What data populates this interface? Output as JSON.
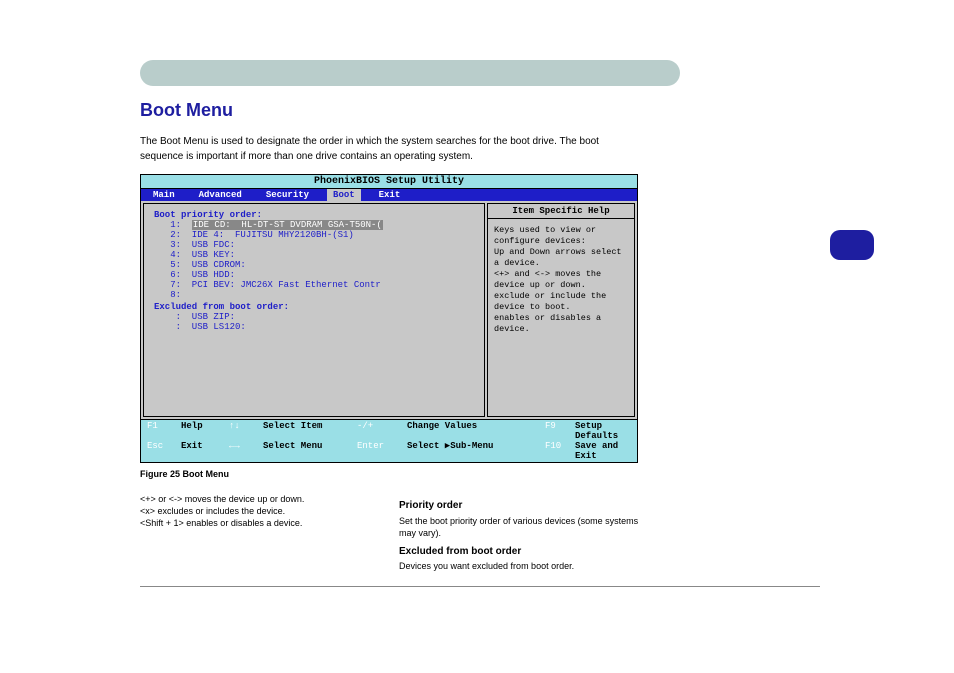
{
  "page_badge": "",
  "chapter": "",
  "section_title": "Boot Menu",
  "intro": "The Boot Menu is used to designate the order in which the system searches for the boot drive. The boot sequence is important if more than one drive contains an operating system.",
  "bios": {
    "utility_title": "PhoenixBIOS Setup Utility",
    "tabs": [
      "Main",
      "Advanced",
      "Security",
      "Boot",
      "Exit"
    ],
    "active_tab": "Boot",
    "left": {
      "heading": "Boot priority order:",
      "items": [
        {
          "n": "1:",
          "txt": "IDE CD:  HL-DT-ST DVDRAM GSA-T50N-(",
          "sel": true
        },
        {
          "n": "2:",
          "txt": "IDE 4:  FUJITSU MHY2120BH-(S1)",
          "sel": false
        },
        {
          "n": "3:",
          "txt": "USB FDC:",
          "sel": false
        },
        {
          "n": "4:",
          "txt": "USB KEY:",
          "sel": false
        },
        {
          "n": "5:",
          "txt": "USB CDROM:",
          "sel": false
        },
        {
          "n": "6:",
          "txt": "USB HDD:",
          "sel": false
        },
        {
          "n": "7:",
          "txt": "PCI BEV: JMC26X Fast Ethernet Contr",
          "sel": false
        },
        {
          "n": "8:",
          "txt": "",
          "sel": false
        }
      ],
      "excluded_heading": "Excluded from boot order:",
      "excluded": [
        {
          "n": ":",
          "txt": "USB ZIP:"
        },
        {
          "n": ":",
          "txt": "USB LS120:"
        }
      ]
    },
    "help": {
      "title": "Item Specific Help",
      "body": "Keys used to view or configure devices:\nUp and Down arrows select a device.\n<+> and <-> moves the device up or down.\n<x> exclude or include the device to boot.\n<Shift + 1> enables or disables a device."
    },
    "footer": [
      {
        "k": "F1",
        "l": "Help",
        "k2": "↑↓",
        "l2": "Select Item",
        "k3": "-/+",
        "l3": "Change Values",
        "k4": "F9",
        "l4": "Setup Defaults"
      },
      {
        "k": "Esc",
        "l": "Exit",
        "k2": "←→",
        "l2": "Select Menu",
        "k3": "Enter",
        "l3": "Select ▶Sub-Menu",
        "k4": "F10",
        "l4": "Save and Exit"
      }
    ]
  },
  "figure_label": "Figure 25  Boot Menu",
  "col_left": {
    "bullets": [
      "<+> or <-> moves the device up or down.",
      "<x> excludes or includes the device.",
      "<Shift + 1> enables or disables a device."
    ]
  },
  "col_right": {
    "h1": "Priority order",
    "p1": "Set the boot priority order of various devices (some systems may vary).",
    "h2": "Excluded from boot order",
    "p2": "Devices you want excluded from boot order."
  },
  "footer_text": "",
  "imprint": ""
}
